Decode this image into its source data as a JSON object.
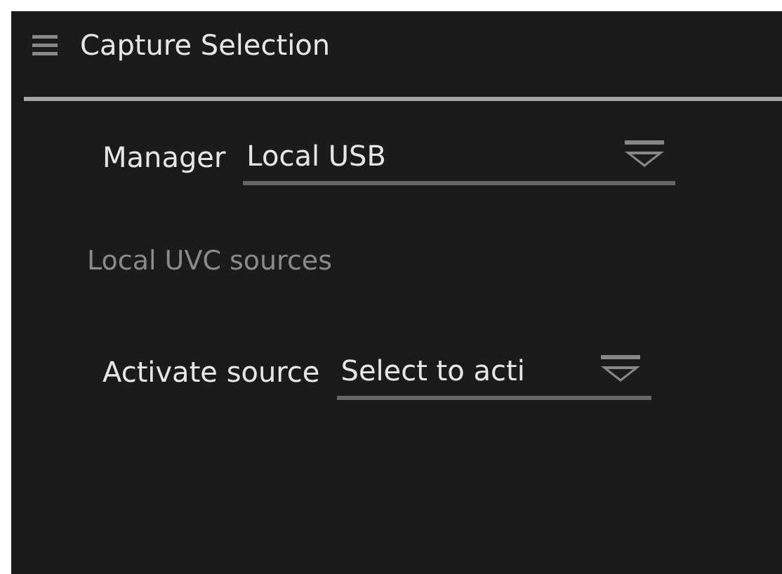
{
  "panel": {
    "title": "Capture Selection"
  },
  "manager": {
    "label": "Manager",
    "value": "Local USB"
  },
  "section": {
    "heading": "Local UVC sources"
  },
  "activate": {
    "label": "Activate source",
    "value": "Select to acti"
  }
}
